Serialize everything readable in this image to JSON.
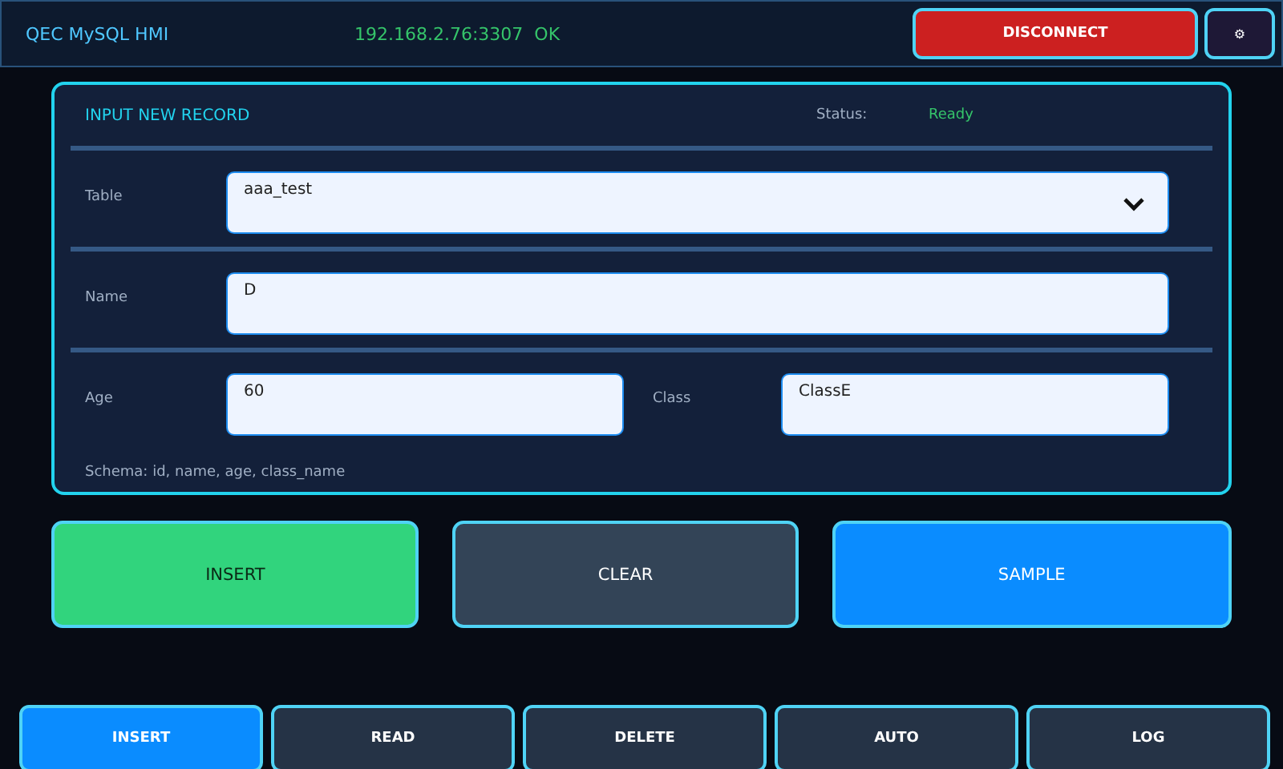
{
  "header": {
    "title": "QEC MySQL HMI",
    "connection": "192.168.2.76:3307  OK",
    "disconnect_button": "DISCONNECT",
    "settings_button": "⚙"
  },
  "form": {
    "title": "INPUT NEW RECORD",
    "status_label": "Status:",
    "status_value": "Ready",
    "table": {
      "label": "Table",
      "value": "aaa_test"
    },
    "name": {
      "label": "Name",
      "value": "D"
    },
    "age": {
      "label": "Age",
      "value": "60"
    },
    "class": {
      "label": "Class",
      "value": "ClassE"
    },
    "schema": "Schema: id, name, age, class_name"
  },
  "actions": [
    {
      "label": "INSERT",
      "kind": "success"
    },
    {
      "label": "CLEAR",
      "kind": "neutral"
    },
    {
      "label": "SAMPLE",
      "kind": "info"
    }
  ],
  "tabs": [
    {
      "label": "INSERT",
      "selected": true
    },
    {
      "label": "READ",
      "selected": false
    },
    {
      "label": "DELETE",
      "selected": false
    },
    {
      "label": "AUTO",
      "selected": false
    },
    {
      "label": "LOG",
      "selected": false
    }
  ]
}
